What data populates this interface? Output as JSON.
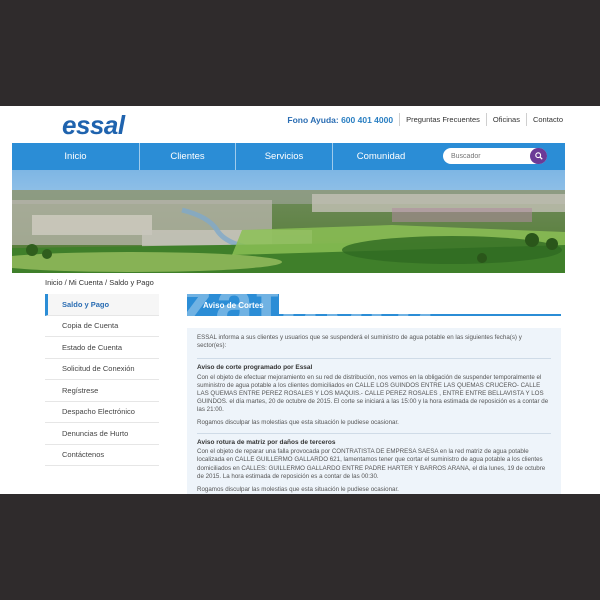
{
  "logo": {
    "text": "essal",
    "color": "#1f63ae"
  },
  "topnav": {
    "help_label": "Fono Ayuda:",
    "help_number": "600 401 4000",
    "links": [
      "Preguntas Frecuentes",
      "Oficinas",
      "Contacto"
    ]
  },
  "mainnav": {
    "items": [
      "Inicio",
      "Clientes",
      "Servicios",
      "Comunidad"
    ],
    "accent": "#2b8dd6"
  },
  "search": {
    "placeholder": "Buscador",
    "icon": "search-icon",
    "button_color": "#6b3a97"
  },
  "breadcrumb": "Inicio / Mi Cuenta / Saldo y Pago",
  "sidebar": {
    "items": [
      "Saldo y Pago",
      "Copia de Cuenta",
      "Estado de Cuenta",
      "Solicitud de Conexión",
      "Regístrese",
      "Despacho Electrónico",
      "Denuncias de Hurto",
      "Contáctenos"
    ],
    "active_index": 0
  },
  "tab": {
    "label": "Aviso de Cortes"
  },
  "content": {
    "intro": "ESSAL informa a sus clientes y usuarios que se suspenderá el suministro de agua potable en las siguientes fecha(s) y sector(es):",
    "notices": [
      {
        "title": "Aviso de corte programado por Essal",
        "body": "Con el objeto de efectuar mejoramiento en su red de distribución, nos vemos en la obligación de suspender temporalmente el suministro de agua potable a los clientes domiciliados en CALLE LOS GUINDOS ENTRE LAS QUEMAS CRUCERO- CALLE LAS QUEMAS ENTRE PEREZ ROSALES Y LOS MAQUIS.- CALLE PEREZ ROSALES , ENTRE ENTRE BELLAVISTA Y LOS GUINDOS. el día martes, 20 de octubre de 2015. El corte se iniciará a las 15:00 y la hora estimada de reposición es a contar de las 21:00.",
        "apology": "Rogamos disculpar las molestias que esta situación le pudiese ocasionar."
      },
      {
        "title": "Aviso rotura de matriz por daños de terceros",
        "body": "Con el objeto de reparar una falla provocada por CONTRATISTA DE EMPRESA SAESA en la red matriz de agua potable localizada en CALLE GUILLERMO GALLARDO 621, lamentamos tener que cortar el suministro de agua potable a los clientes domiciliados en CALLES: GUILLERMO GALLARDO ENTRE PADRE HARTER Y BARROS ARANA, el día lunes, 19 de octubre de 2015. La hora estimada de reposición es a contar de las 00:30.",
        "apology": "Rogamos disculpar las molestias que esta situación le pudiese ocasionar."
      }
    ]
  },
  "watermark": "zatabra"
}
